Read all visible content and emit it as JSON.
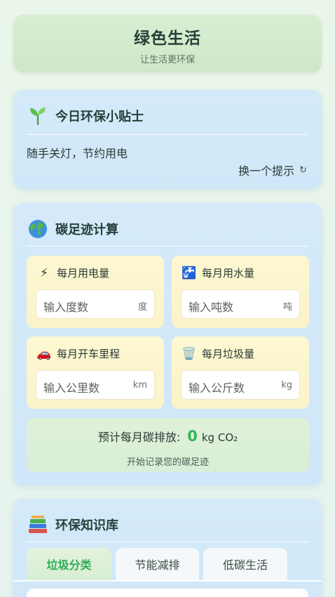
{
  "header": {
    "title": "绿色生活",
    "subtitle": "让生活更环保"
  },
  "tip": {
    "icon": "seedling-icon",
    "title": "今日环保小贴士",
    "text": "随手关灯，节约用电",
    "next_label": "换一个提示",
    "next_icon": "↻"
  },
  "carbon": {
    "icon": "globe-icon",
    "title": "碳足迹计算",
    "inputs": [
      {
        "icon": "lightning-icon",
        "glyph": "⚡",
        "label": "每月用电量",
        "placeholder": "输入度数",
        "unit": "度"
      },
      {
        "icon": "water-faucet-icon",
        "glyph": "🚰",
        "label": "每月用水量",
        "placeholder": "输入吨数",
        "unit": "吨"
      },
      {
        "icon": "car-icon",
        "glyph": "🚗",
        "label": "每月开车里程",
        "placeholder": "输入公里数",
        "unit": "km"
      },
      {
        "icon": "trash-can-icon",
        "glyph": "🗑️",
        "label": "每月垃圾量",
        "placeholder": "输入公斤数",
        "unit": "kg"
      }
    ],
    "estimate_label": "预计每月碳排放:",
    "estimate_value": "0",
    "estimate_unit": "kg CO₂",
    "estimate_hint": "开始记录您的碳足迹"
  },
  "knowledge": {
    "icon": "books-icon",
    "title": "环保知识库",
    "tabs": [
      {
        "label": "垃圾分类",
        "active": true
      },
      {
        "label": "节能减排",
        "active": false
      },
      {
        "label": "低碳生活",
        "active": false
      }
    ]
  },
  "colors": {
    "accent_green": "#32b45a",
    "header_bg": "#d4ebcc",
    "card_bg": "#d2e9f9",
    "input_bg": "#fcf6cd"
  }
}
